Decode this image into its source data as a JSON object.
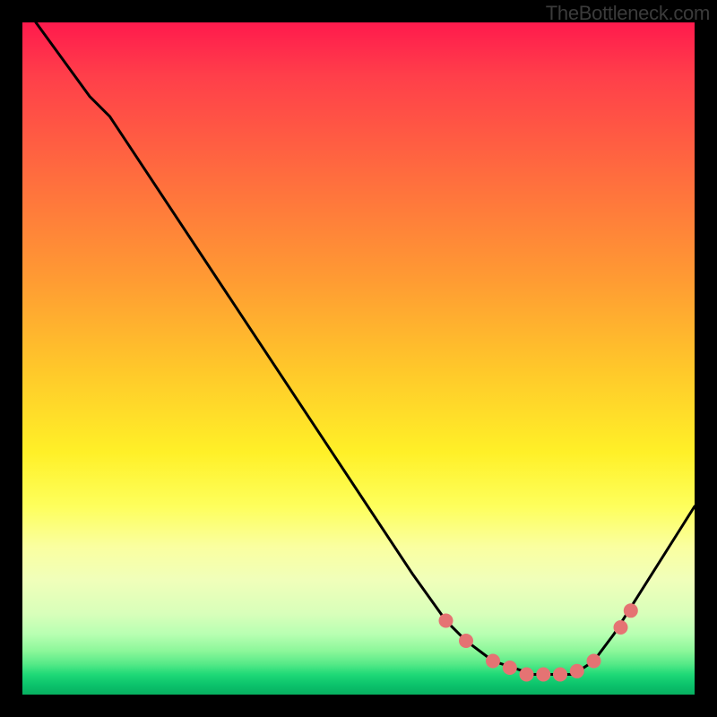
{
  "watermark": "TheBottleneck.com",
  "chart_data": {
    "type": "line",
    "title": "",
    "xlabel": "",
    "ylabel": "",
    "xlim": [
      0,
      100
    ],
    "ylim": [
      0,
      100
    ],
    "grid": false,
    "series": [
      {
        "name": "bottleneck-curve",
        "x": [
          2,
          10,
          13,
          58,
          63,
          66,
          70,
          76,
          82,
          85,
          88,
          100
        ],
        "y": [
          100,
          89,
          86,
          18,
          11,
          8,
          5,
          3,
          3,
          5,
          9,
          28
        ]
      }
    ],
    "markers": {
      "name": "highlight-dots",
      "color": "#e57373",
      "points": [
        {
          "x": 63,
          "y": 11
        },
        {
          "x": 66,
          "y": 8
        },
        {
          "x": 70,
          "y": 5
        },
        {
          "x": 72.5,
          "y": 4
        },
        {
          "x": 75,
          "y": 3
        },
        {
          "x": 77.5,
          "y": 3
        },
        {
          "x": 80,
          "y": 3
        },
        {
          "x": 82.5,
          "y": 3.5
        },
        {
          "x": 85,
          "y": 5
        },
        {
          "x": 89,
          "y": 10
        },
        {
          "x": 90.5,
          "y": 12.5
        }
      ]
    },
    "gradient_stops": [
      {
        "pos": 0,
        "color": "#ff1a4d"
      },
      {
        "pos": 38,
        "color": "#ff9a33"
      },
      {
        "pos": 64,
        "color": "#fff028"
      },
      {
        "pos": 92,
        "color": "#8cf79a"
      },
      {
        "pos": 100,
        "color": "#07b060"
      }
    ]
  }
}
